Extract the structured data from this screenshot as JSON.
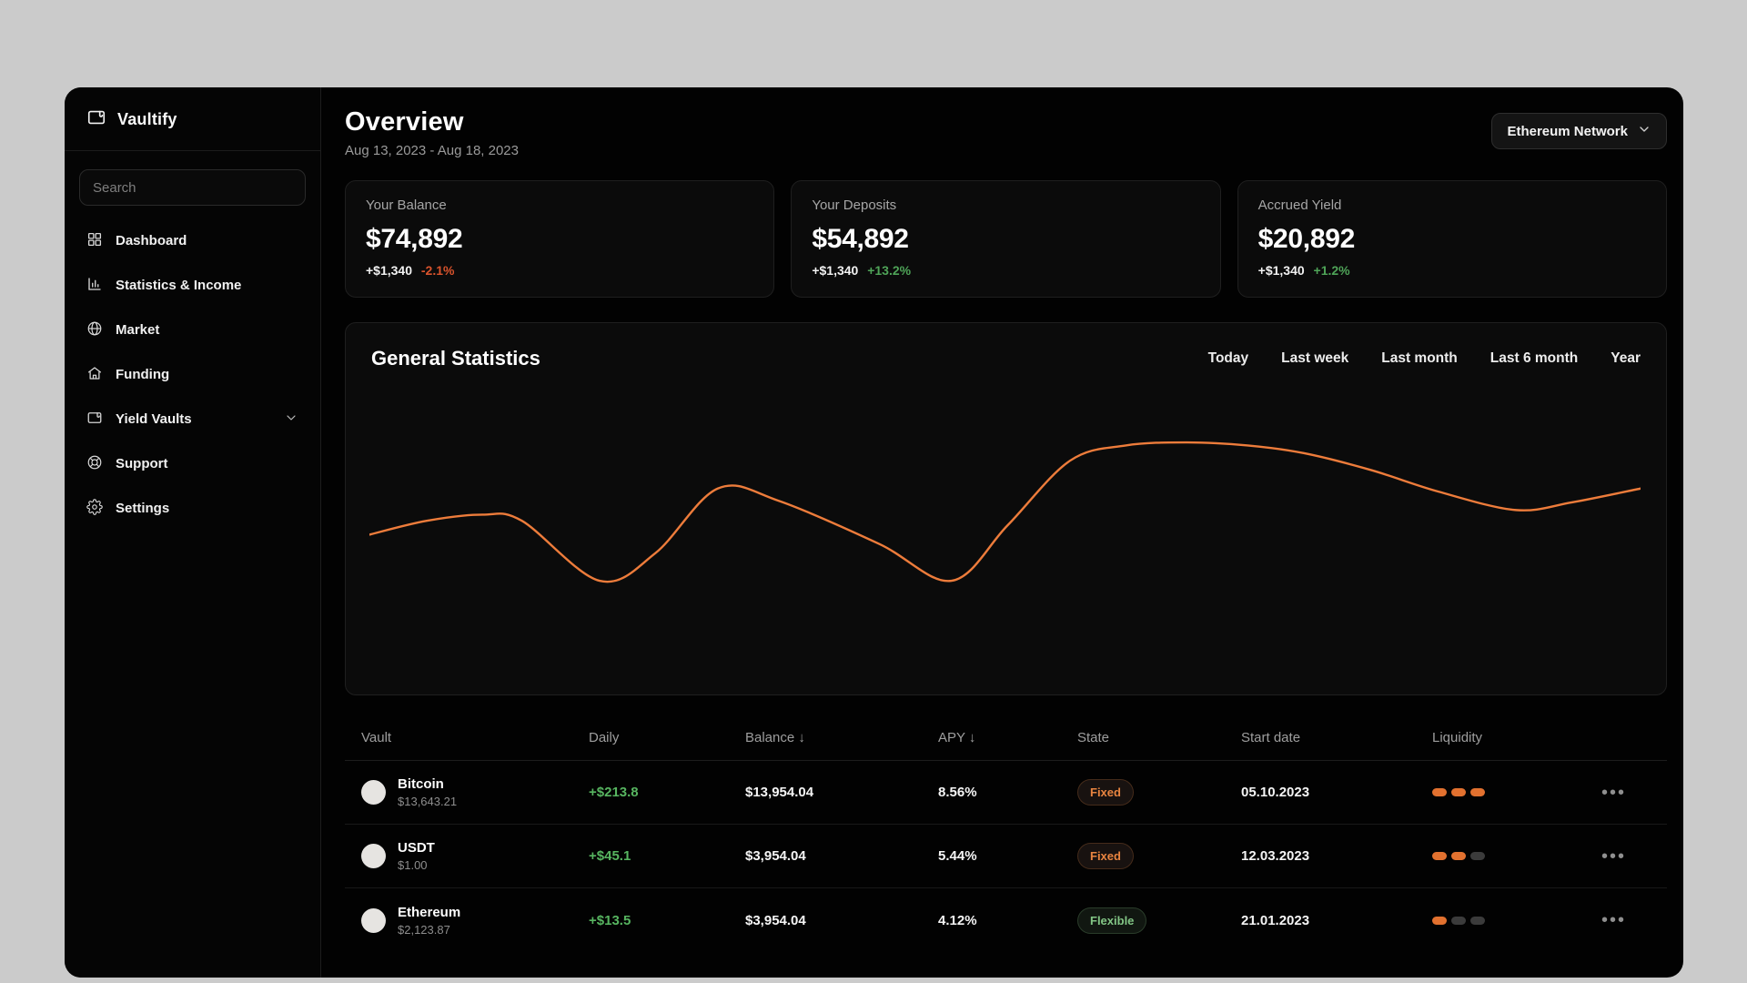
{
  "colors": {
    "page_bg": "#cbcbcb",
    "panel_bg": "#020202",
    "card_bg": "#0b0b0b",
    "accent_orange": "#ed7c3b",
    "pill_orange": "#e2712f",
    "positive_green": "#4fa458",
    "negative_orange": "#d9532c"
  },
  "sidebar": {
    "logo_title": "Vaultify",
    "search_placeholder": "Search",
    "items": [
      {
        "label": "Dashboard",
        "icon": "dashboard-grid-icon"
      },
      {
        "label": "Statistics & Income",
        "icon": "bar-chart-icon"
      },
      {
        "label": "Market",
        "icon": "globe-icon"
      },
      {
        "label": "Funding",
        "icon": "house-icon"
      },
      {
        "label": "Yield Vaults",
        "icon": "wallet-icon",
        "has_chevron": true
      },
      {
        "label": "Support",
        "icon": "life-buoy-icon"
      },
      {
        "label": "Settings",
        "icon": "gear-icon"
      }
    ]
  },
  "header": {
    "title": "Overview",
    "date_range": "Aug 13, 2023 - Aug 18, 2023",
    "network_selector": "Ethereum Network"
  },
  "stat_cards": [
    {
      "label": "Your Balance",
      "value": "$74,892",
      "delta": "+$1,340",
      "pct": "-2.1%",
      "pct_color": "#d9532c"
    },
    {
      "label": "Your Deposits",
      "value": "$54,892",
      "delta": "+$1,340",
      "pct": "+13.2%",
      "pct_color": "#4fa458"
    },
    {
      "label": "Accrued Yield",
      "value": "$20,892",
      "delta": "+$1,340",
      "pct": "+1.2%",
      "pct_color": "#4fa458"
    }
  ],
  "statistics_panel": {
    "title": "General Statistics",
    "filters": [
      "Today",
      "Last week",
      "Last month",
      "Last 6 month",
      "Year"
    ]
  },
  "chart_data": {
    "type": "line",
    "title": "General Statistics",
    "xlabel": "",
    "ylabel": "",
    "grid": false,
    "axes_visible": false,
    "legend": "none",
    "line_color": "#ed7c3b",
    "x_range_pct": [
      0,
      100
    ],
    "y_range_pct": [
      0,
      100
    ],
    "x": [
      0,
      4.5,
      8.9,
      12,
      18.1,
      22.5,
      27.4,
      32.2,
      40.1,
      45.8,
      50.2,
      55.1,
      59.5,
      64.3,
      69.1,
      73.5,
      78.8,
      84.1,
      90.2,
      94.6,
      100
    ],
    "y": [
      32,
      41,
      45,
      41,
      2,
      20,
      62,
      54,
      26,
      2,
      38,
      80,
      90,
      92,
      90,
      85,
      74,
      60,
      48,
      53,
      62
    ]
  },
  "table": {
    "columns": {
      "vault": "Vault",
      "daily": "Daily",
      "balance": "Balance",
      "balance_sort": "↓",
      "apy": "APY",
      "apy_sort": "↓",
      "state": "State",
      "start_date": "Start date",
      "liquidity": "Liquidity"
    },
    "rows": [
      {
        "name": "Bitcoin",
        "price": "$13,643.21",
        "daily": "+$213.8",
        "daily_color": "#57b560",
        "balance": "$13,954.04",
        "apy": "8.56%",
        "state": {
          "label": "Fixed",
          "type": "fixed"
        },
        "start_date": "05.10.2023",
        "liquidity": [
          true,
          true,
          true
        ],
        "menu": "•••"
      },
      {
        "name": "USDT",
        "price": "$1.00",
        "daily": "+$45.1",
        "daily_color": "#57b560",
        "balance": "$3,954.04",
        "apy": "5.44%",
        "state": {
          "label": "Fixed",
          "type": "fixed"
        },
        "start_date": "12.03.2023",
        "liquidity": [
          true,
          true,
          false
        ],
        "menu": "•••"
      },
      {
        "name": "Ethereum",
        "price": "$2,123.87",
        "daily": "+$13.5",
        "daily_color": "#57b560",
        "balance": "$3,954.04",
        "apy": "4.12%",
        "state": {
          "label": "Flexible",
          "type": "flexible"
        },
        "start_date": "21.01.2023",
        "liquidity": [
          true,
          false,
          false
        ],
        "menu": "•••"
      }
    ]
  }
}
